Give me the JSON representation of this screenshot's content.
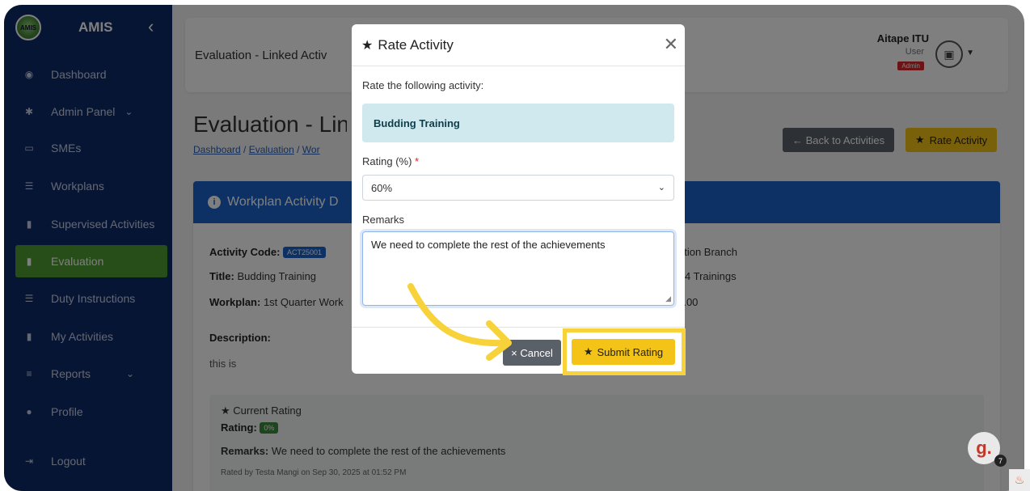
{
  "sidebar": {
    "logo_text": "AMIS",
    "brand": "AMIS",
    "collapse_icon": "‹",
    "items": [
      {
        "label": "Dashboard",
        "icon": "◉"
      },
      {
        "label": "Admin Panel",
        "icon": "✱",
        "chevron": "⌄"
      },
      {
        "label": "SMEs",
        "icon": "▭"
      },
      {
        "label": "Workplans",
        "icon": "☰"
      },
      {
        "label": "Supervised Activities",
        "icon": "▮"
      },
      {
        "label": "Evaluation",
        "icon": "▮"
      },
      {
        "label": "Duty Instructions",
        "icon": "☰"
      },
      {
        "label": "My Activities",
        "icon": "▮"
      },
      {
        "label": "Reports",
        "icon": "≡",
        "chevron": "⌄"
      },
      {
        "label": "Profile",
        "icon": "●"
      },
      {
        "label": "Logout",
        "icon": "⇥"
      }
    ],
    "active_color": "#4f9a32"
  },
  "header": {
    "title": "Evaluation - Linked Activ",
    "user_name": "Aitape ITU",
    "user_role": "User",
    "user_badge": "Admin"
  },
  "page": {
    "title": "Evaluation - Lin",
    "breadcrumb": [
      "Dashboard",
      "Evaluation",
      "Wor"
    ],
    "back_button": "← Back to Activities",
    "rate_button": "Rate Activity"
  },
  "card": {
    "heading": "Workplan Activity D",
    "activity_code_label": "Activity Code:",
    "activity_code": "ACT25001",
    "title_label": "Title:",
    "title_value": "Budding Training",
    "workplan_label": "Workplan:",
    "workplan_value": "1st Quarter Work",
    "description_label": "Description:",
    "description_value": "this is",
    "right_col_1": "ation Branch",
    "right_col_2": "4 Trainings",
    "right_col_3": ").00",
    "current_rating": {
      "heading": "Current Rating",
      "rating_label": "Rating:",
      "rating_value": "0%",
      "remarks_label": "Remarks:",
      "remarks_value": "We need to complete the rest of the achievements",
      "footer": "Rated by Testa Mangi on Sep 30, 2025 at 01:52 PM"
    }
  },
  "modal": {
    "title": "Rate Activity",
    "intro": "Rate the following activity:",
    "activity_name": "Budding Training",
    "rating_label": "Rating (%)",
    "required_mark": "*",
    "rating_value": "60%",
    "remarks_label": "Remarks",
    "remarks_value": "We need to complete the rest of the achievements",
    "cancel_button": "× Cancel",
    "submit_button": "Submit Rating"
  },
  "widget": {
    "badge_letter": "g.",
    "badge_count": "7"
  },
  "colors": {
    "sidebar_bg": "#0f2a6b",
    "primary": "#1a63c9",
    "warning": "#f3c317",
    "highlight": "#f7d23a"
  }
}
